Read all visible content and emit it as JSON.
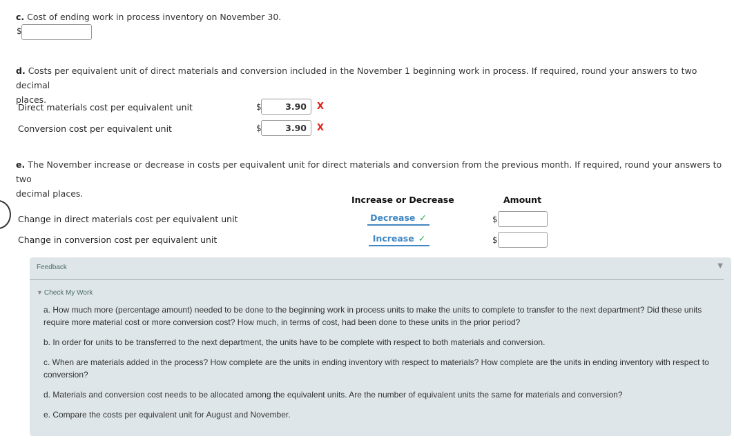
{
  "part_c": {
    "letter": "c.",
    "text": "Cost of ending work in process inventory on November 30.",
    "currency": "$",
    "input_value": ""
  },
  "part_d": {
    "letter": "d.",
    "text_line1": "Costs per equivalent unit of direct materials and conversion included in the November 1 beginning work in process. If required, round your answers to two decimal",
    "text_line2": "places.",
    "rows": [
      {
        "label": "Direct materials cost per equivalent unit",
        "currency": "$",
        "value": "3.90",
        "status": "X",
        "status_meaning": "incorrect"
      },
      {
        "label": "Conversion cost per equivalent unit",
        "currency": "$",
        "value": "3.90",
        "status": "X",
        "status_meaning": "incorrect"
      }
    ]
  },
  "part_e": {
    "letter": "e.",
    "text_line1": "The November increase or decrease in costs per equivalent unit for direct materials and conversion from the previous month. If required, round your answers to two",
    "text_line2": "decimal places.",
    "headers": {
      "direction": "Increase or Decrease",
      "amount": "Amount"
    },
    "rows": [
      {
        "label": "Change in direct materials cost per equivalent unit",
        "selection": "Decrease",
        "status": "✓",
        "status_meaning": "correct",
        "currency": "$",
        "amount": ""
      },
      {
        "label": "Change in conversion cost per equivalent unit",
        "selection": "Increase",
        "status": "✓",
        "status_meaning": "correct",
        "currency": "$",
        "amount": ""
      }
    ]
  },
  "feedback": {
    "title": "Feedback",
    "toggle_icon": "▼",
    "check_my_work": "Check My Work",
    "items": [
      {
        "line1": "a. How much more (percentage amount) needed to be done to the beginning work in process units to make the units to complete to transfer to the next department? Did these units",
        "line2": "require more material cost or more conversion cost? How much, in terms of cost, had been done to these units in the prior period?"
      },
      {
        "line1": "b. In order for units to be transferred to the next department, the units have to be complete with respect to both materials and conversion.",
        "line2": ""
      },
      {
        "line1": "c. When are materials added in the process? How complete are the units in ending inventory with respect to materials? How complete are the units in ending inventory with respect to",
        "line2": "conversion?"
      },
      {
        "line1": "d. Materials and conversion cost needs to be allocated among the equivalent units. Are the number of equivalent units the same for materials and conversion?",
        "line2": ""
      },
      {
        "line1": "e. Compare the costs per equivalent unit for August and November.",
        "line2": ""
      }
    ]
  },
  "colors": {
    "incorrect": "#e0201c",
    "correct": "#1ea84a",
    "select_link": "#3f86c2",
    "feedback_bg": "#dfe6e9"
  }
}
